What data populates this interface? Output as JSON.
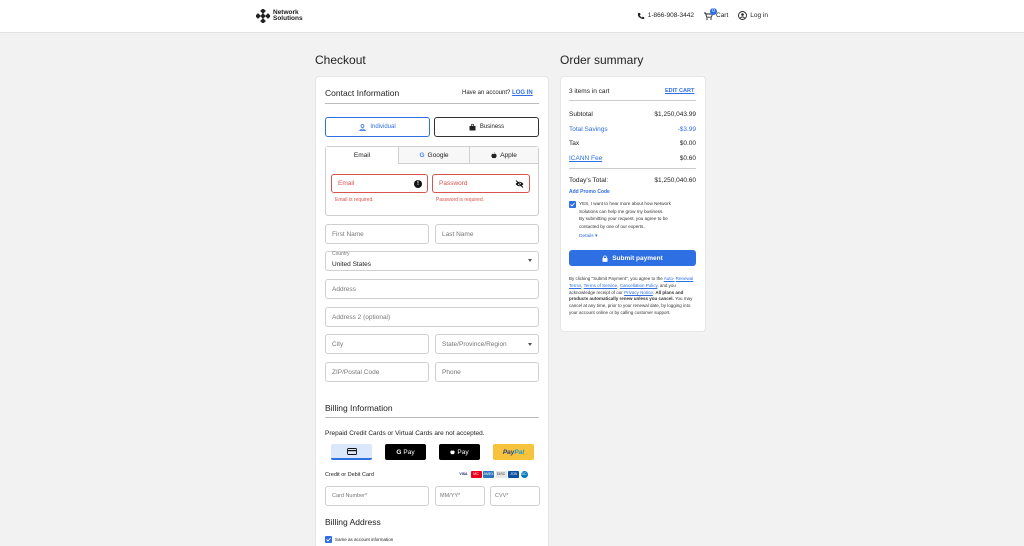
{
  "header": {
    "logo_line1": "Network",
    "logo_line2": "Solutions",
    "phone": "1-866-908-3442",
    "cart_label": "Cart",
    "cart_count": "0",
    "login_label": "Log in"
  },
  "checkout": {
    "title": "Checkout",
    "contact": {
      "title": "Contact Information",
      "have_account": "Have an account?",
      "login_link": "LOG IN",
      "individual": "Individual",
      "business": "Business",
      "tabs": [
        "Email",
        "Google",
        "Apple"
      ],
      "email_placeholder": "Email",
      "password_placeholder": "Password",
      "email_error": "Email is required.",
      "password_error": "Password is required.",
      "first_name": "First Name",
      "last_name": "Last Name",
      "country_label": "Country",
      "country_value": "United States",
      "address": "Address",
      "address2": "Address 2 (optional)",
      "city": "City",
      "state": "State/Province/Region",
      "zip": "ZIP/Postal Code",
      "phone": "Phone"
    },
    "billing": {
      "title": "Billing Information",
      "notice": "Prepaid Credit Cards or Virtual Cards are not accepted.",
      "gpay": "Pay",
      "gpay_g": "G",
      "applepay": "Pay",
      "paypal_1": "Pay",
      "paypal_2": "Pal",
      "card_label": "Credit or Debit Card",
      "card_number": "Card Number*",
      "expiry": "MM/YY*",
      "cvv": "CVV*",
      "brands": [
        "VISA",
        "MC",
        "AMEX",
        "DISC",
        "JCB",
        "DC"
      ]
    },
    "billing_address": {
      "title": "Billing Address",
      "same_as": "Same as account information"
    }
  },
  "summary": {
    "title": "Order summary",
    "items_in_cart": "3 items in cart",
    "edit_cart": "EDIT CART",
    "subtotal_label": "Subtotal",
    "subtotal": "$1,250,043.99",
    "savings_label": "Total Savings",
    "savings": "-$3.99",
    "tax_label": "Tax",
    "tax": "$0.00",
    "icann_label": "ICANN Fee",
    "icann": "$0.60",
    "total_label": "Today's Total:",
    "total": "$1,250,040.60",
    "promo": "Add Promo Code",
    "optin_1": "YES, I want to hear more about how Network",
    "optin_2": "Solutions can help me grow my business.",
    "optin_3": "By submitting your request, you agree to be",
    "optin_4": "contacted by one of our experts.",
    "details": "Details",
    "submit": "Submit payment",
    "legal_1": "By clicking \"Submit Payment\", you agree to the",
    "legal_auto": "Auto-",
    "legal_renewal": "Renewal Terms",
    "legal_tos": "Terms of Service",
    "legal_cancel": "Cancellation Policy",
    "legal_2": "and you acknowledge receipt of our",
    "legal_privacy": "Privacy Notice",
    "legal_bold": "All plans and products automatically renew unless you cancel.",
    "legal_3": "You may cancel at any time, prior to your renewal date, by logging into your account online or by calling customer support."
  },
  "colors": {
    "accent": "#2e6fe4",
    "error": "#d9534f",
    "paypal": "#f8c33c"
  }
}
